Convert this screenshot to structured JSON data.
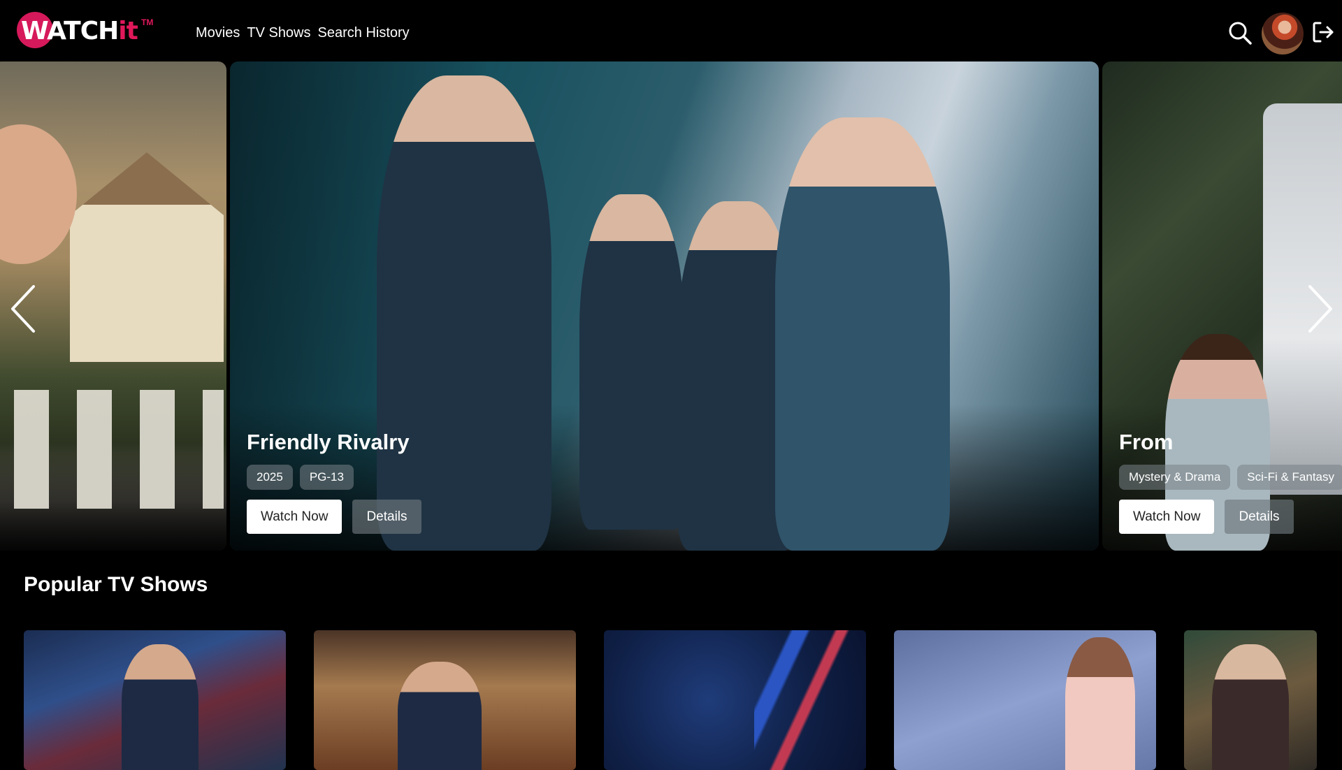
{
  "brand": {
    "logo_main": "WATCH",
    "logo_accent": "it",
    "logo_tm": "TM"
  },
  "nav": {
    "items": [
      "Movies",
      "TV Shows",
      "Search History"
    ]
  },
  "header_icons": {
    "search": "search-icon",
    "avatar": "user-avatar",
    "logout": "logout-icon"
  },
  "hero": {
    "slides": [
      {
        "title": "",
        "tags": [],
        "poster": "woman-with-house-and-fence"
      },
      {
        "title": "Friendly Rivalry",
        "tags": [
          "2025",
          "PG-13"
        ],
        "watch_label": "Watch Now",
        "details_label": "Details",
        "poster": "schoolgirls-in-uniform"
      },
      {
        "title": "From",
        "tags": [
          "Mystery & Drama",
          "Sci-Fi & Fantasy"
        ],
        "watch_label": "Watch Now",
        "details_label": "Details",
        "poster": "woman-in-forest-with-rv"
      }
    ],
    "prev_icon": "chevron-left-icon",
    "next_icon": "chevron-right-icon"
  },
  "popular": {
    "title": "Popular TV Shows",
    "cards": [
      {
        "poster": "late-show-host-city-night"
      },
      {
        "poster": "tonight-show-host-desk"
      },
      {
        "poster": "news-world-map"
      },
      {
        "poster": "news-anchor-pink-jacket"
      },
      {
        "poster": "talk-show-host-classic"
      }
    ]
  },
  "colors": {
    "accent": "#e0185a",
    "background": "#000000",
    "button_primary": "#ffffff"
  }
}
